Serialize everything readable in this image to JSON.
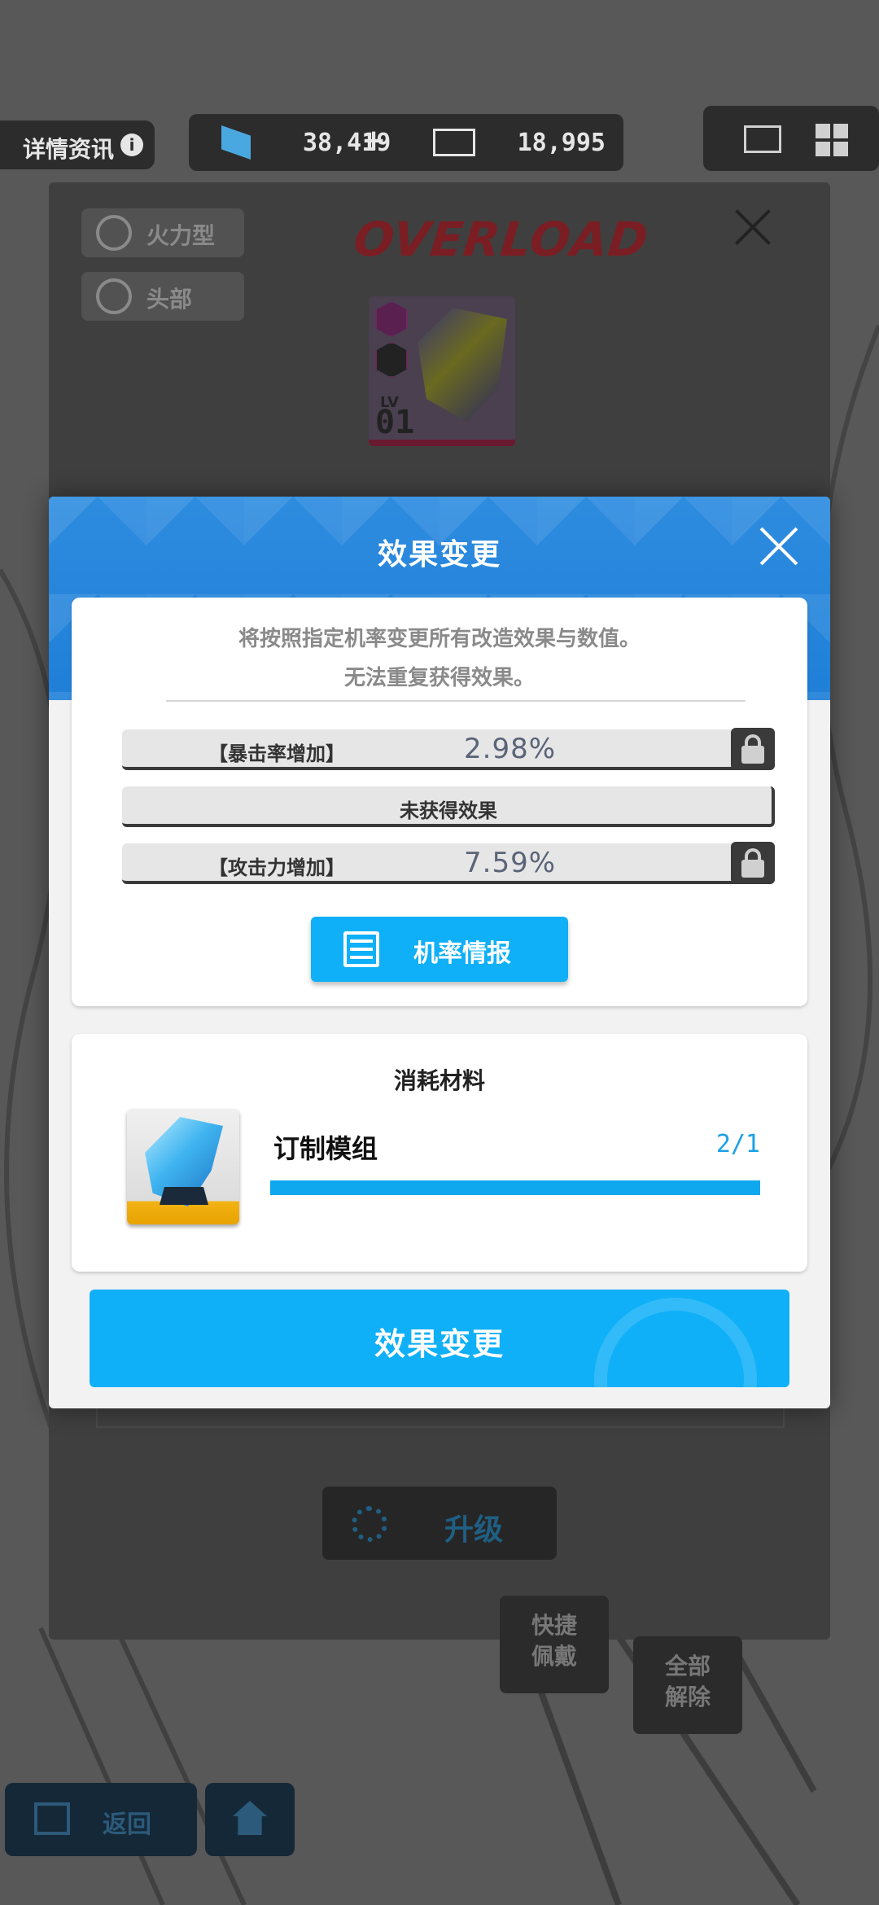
{
  "background": {
    "topbar": {
      "detail_label": "详情资讯",
      "info_icon": "i",
      "currency1_value": "38,419",
      "currency1_plus": "+",
      "currency2_value": "18,995"
    },
    "module_panel": {
      "tags": [
        "火力型",
        "头部"
      ],
      "logo_text": "OVERLOAD",
      "module_level_label": "LV",
      "module_level": "01",
      "upgrade_label": "升级"
    },
    "side_buttons": {
      "quick_equip": "快捷佩戴",
      "release_all": "全部解除"
    },
    "bottom_nav": {
      "back_label": "返回"
    }
  },
  "dialog": {
    "title": "效果变更",
    "description_line1": "将按照指定机率变更所有改造效果与数值。",
    "description_line2": "无法重复获得效果。",
    "effects": [
      {
        "name": "【暴击率增加】",
        "value": "2.98%",
        "locked": false
      },
      {
        "name": "未获得效果",
        "value": "",
        "locked": null
      },
      {
        "name": "【攻击力增加】",
        "value": "7.59%",
        "locked": false
      }
    ],
    "probability_button": "机率情报",
    "materials": {
      "title": "消耗材料",
      "item_name": "订制模组",
      "item_count": "2/1",
      "progress": 1.0
    },
    "confirm_button": "效果变更"
  },
  "colors": {
    "accent_blue": "#0fb0f7",
    "header_blue": "#1f7fd8",
    "count_blue": "#1ba1e8",
    "overload_red": "#7a1e24"
  },
  "icons": {
    "close": "close-icon",
    "lock": "lock-icon",
    "list": "list-icon",
    "crystal": "crystal-icon"
  }
}
